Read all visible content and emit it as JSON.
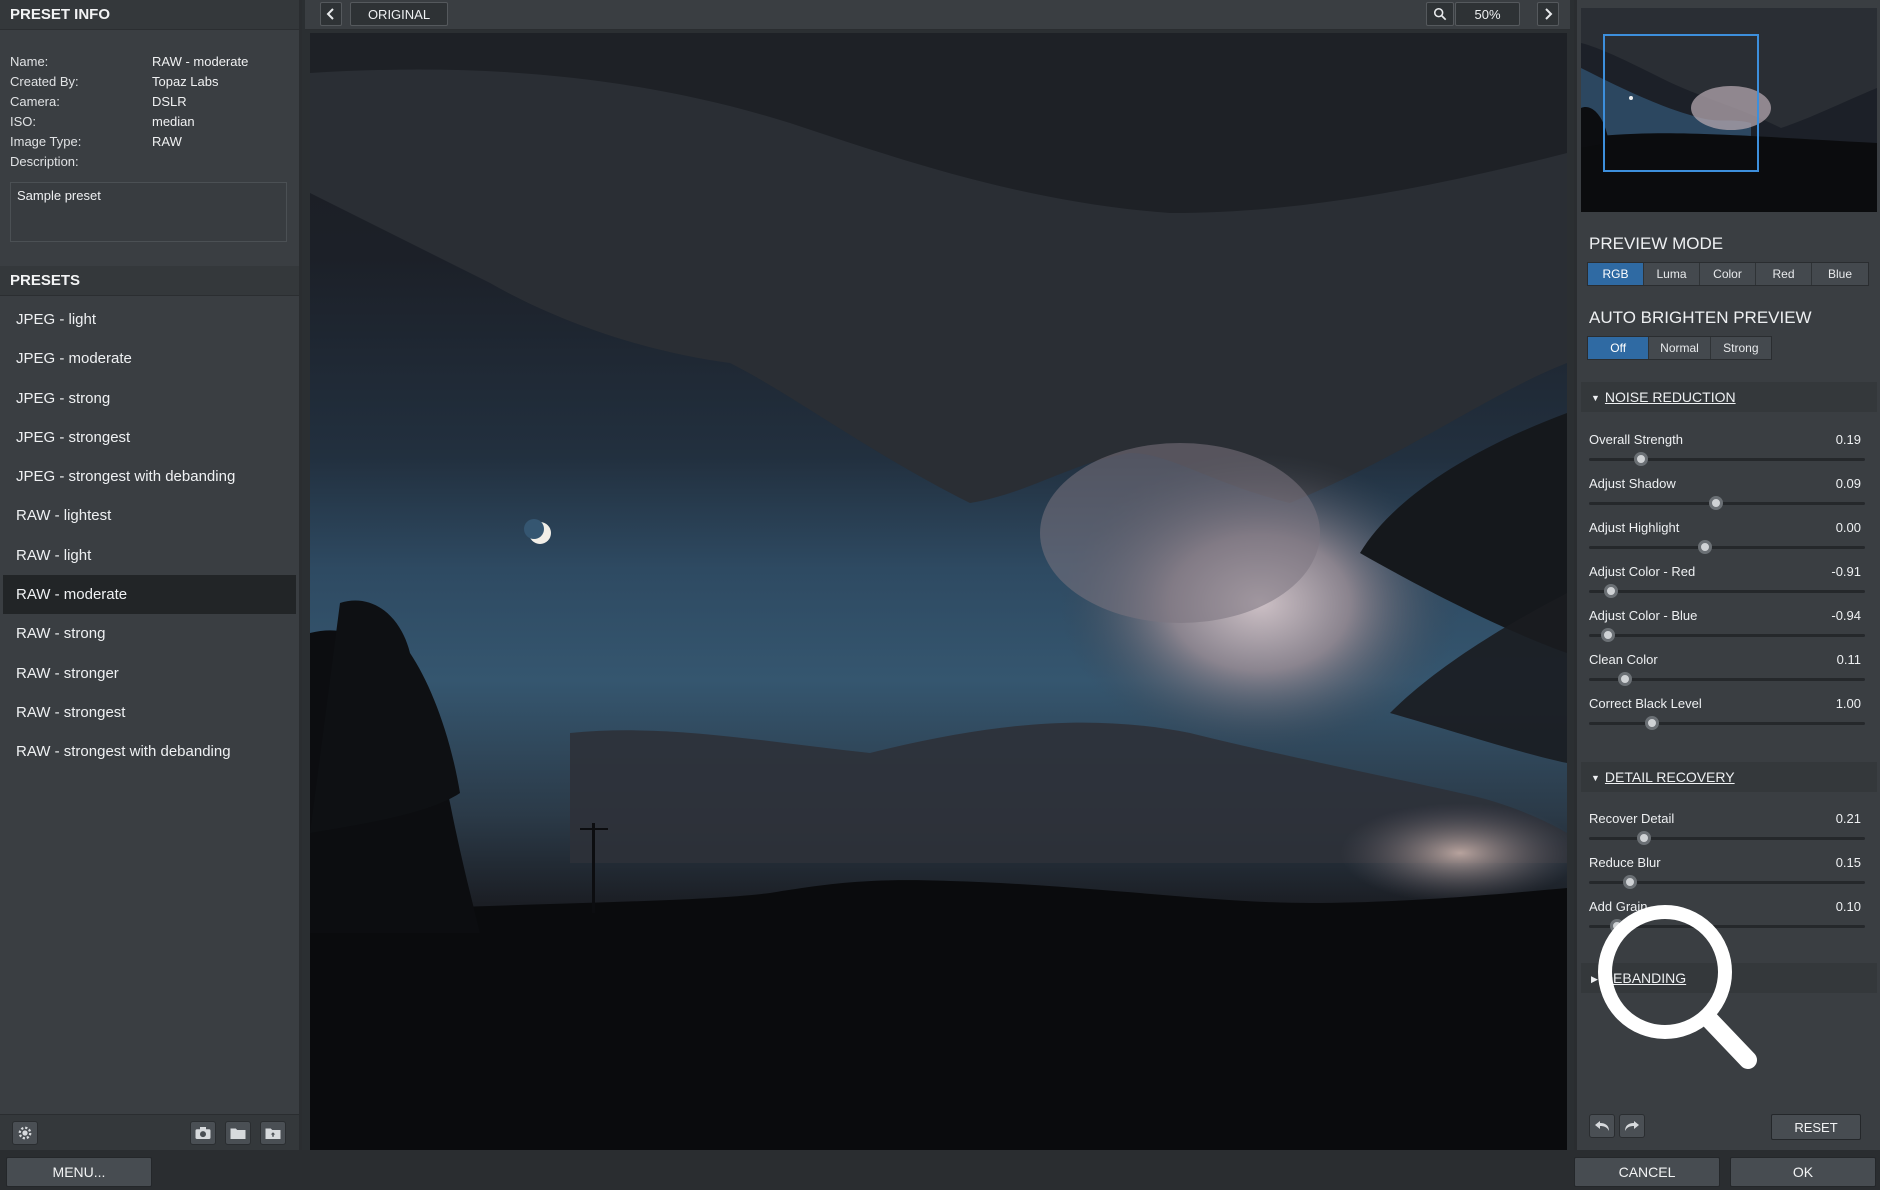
{
  "preset_info": {
    "heading": "PRESET INFO",
    "rows": [
      {
        "key": "Name:",
        "value": "RAW - moderate"
      },
      {
        "key": "Created By:",
        "value": "Topaz Labs"
      },
      {
        "key": "Camera:",
        "value": "DSLR"
      },
      {
        "key": "ISO:",
        "value": "median"
      },
      {
        "key": "Image Type:",
        "value": "RAW"
      },
      {
        "key": "Description:",
        "value": ""
      }
    ],
    "description": "Sample preset"
  },
  "presets": {
    "heading": "PRESETS",
    "selected": "RAW - moderate",
    "items": [
      "JPEG - light",
      "JPEG - moderate",
      "JPEG - strong",
      "JPEG - strongest",
      "JPEG - strongest with debanding",
      "RAW - lightest",
      "RAW - light",
      "RAW - moderate",
      "RAW - strong",
      "RAW - stronger",
      "RAW - strongest",
      "RAW - strongest with debanding"
    ]
  },
  "toolbar": {
    "original_label": "ORIGINAL",
    "zoom": "50%"
  },
  "preview_mode": {
    "heading": "PREVIEW MODE",
    "options": [
      "RGB",
      "Luma",
      "Color",
      "Red",
      "Blue"
    ],
    "selected": "RGB"
  },
  "auto_brighten": {
    "heading": "AUTO BRIGHTEN PREVIEW",
    "options": [
      "Off",
      "Normal",
      "Strong"
    ],
    "selected": "Off"
  },
  "noise_reduction": {
    "heading": "NOISE REDUCTION",
    "sliders": [
      {
        "label": "Overall Strength",
        "value": "0.19",
        "position": 0.19
      },
      {
        "label": "Adjust Shadow",
        "value": "0.09",
        "position": 0.46
      },
      {
        "label": "Adjust Highlight",
        "value": "0.00",
        "position": 0.42
      },
      {
        "label": "Adjust Color - Red",
        "value": "-0.91",
        "position": 0.08
      },
      {
        "label": "Adjust Color - Blue",
        "value": "-0.94",
        "position": 0.07
      },
      {
        "label": "Clean Color",
        "value": "0.11",
        "position": 0.13
      },
      {
        "label": "Correct Black Level",
        "value": "1.00",
        "position": 0.23
      }
    ]
  },
  "detail_recovery": {
    "heading": "DETAIL RECOVERY",
    "sliders": [
      {
        "label": "Recover Detail",
        "value": "0.21",
        "position": 0.2
      },
      {
        "label": "Reduce Blur",
        "value": "0.15",
        "position": 0.15
      },
      {
        "label": "Add Grain",
        "value": "0.10",
        "position": 0.1
      }
    ]
  },
  "debanding": {
    "heading": "DEBANDING"
  },
  "footer": {
    "reset": "RESET",
    "menu": "MENU...",
    "cancel": "CANCEL",
    "ok": "OK"
  },
  "colors": {
    "accent": "#2f6aa3",
    "navigator_frame": "#3d8fdc",
    "panel": "#3a3e42"
  }
}
